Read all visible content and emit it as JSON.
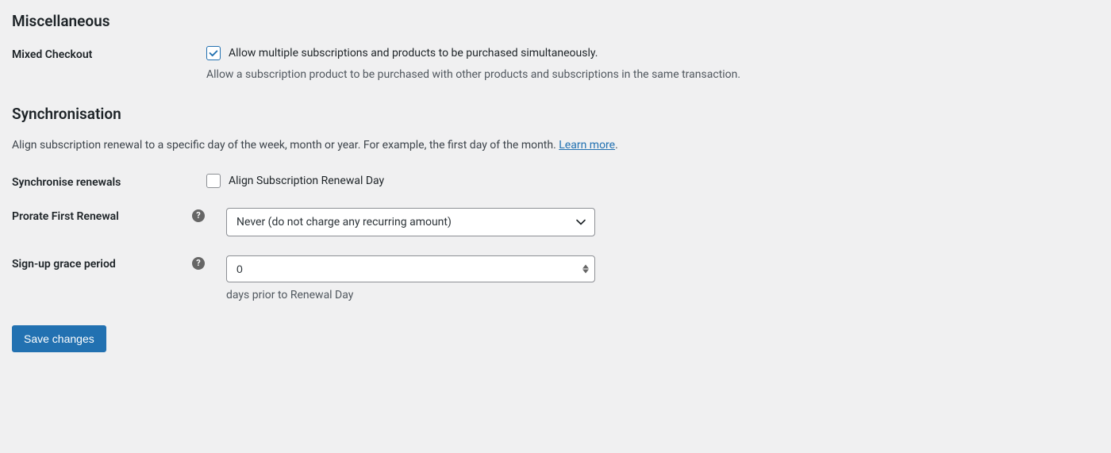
{
  "miscellaneous": {
    "heading": "Miscellaneous",
    "mixed_checkout": {
      "label": "Mixed Checkout",
      "checkbox_label": "Allow multiple subscriptions and products to be purchased simultaneously.",
      "help_text": "Allow a subscription product to be purchased with other products and subscriptions in the same transaction.",
      "checked": true
    }
  },
  "synchronisation": {
    "heading": "Synchronisation",
    "description_prefix": "Align subscription renewal to a specific day of the week, month or year. For example, the first day of the month. ",
    "learn_more": "Learn more",
    "description_suffix": ".",
    "synchronise_renewals": {
      "label": "Synchronise renewals",
      "checkbox_label": "Align Subscription Renewal Day",
      "checked": false
    },
    "prorate_first_renewal": {
      "label": "Prorate First Renewal",
      "selected": "Never (do not charge any recurring amount)"
    },
    "signup_grace_period": {
      "label": "Sign-up grace period",
      "value": "0",
      "suffix": "days prior to Renewal Day"
    }
  },
  "save_button": "Save changes"
}
